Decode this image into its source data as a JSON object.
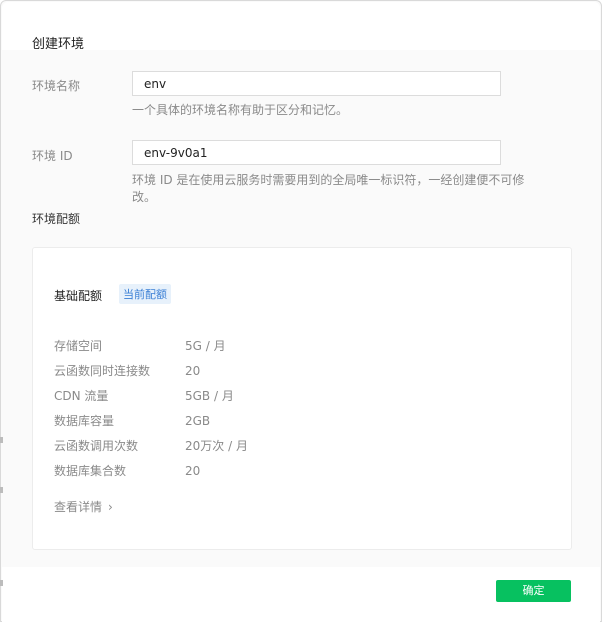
{
  "dialog": {
    "title": "创建环境",
    "confirm_label": "确定"
  },
  "form": {
    "env_name": {
      "label": "环境名称",
      "value": "env",
      "hint": "一个具体的环境名称有助于区分和记忆。"
    },
    "env_id": {
      "label": "环境 ID",
      "value": "env-9v0a1",
      "hint": "环境 ID 是在使用云服务时需要用到的全局唯一标识符，一经创建便不可修改。"
    }
  },
  "quota": {
    "section_title": "环境配额",
    "plan_name": "基础配额",
    "plan_badge": "当前配额",
    "rows": [
      {
        "key": "存储空间",
        "value": "5G / 月"
      },
      {
        "key": "云函数同时连接数",
        "value": "20"
      },
      {
        "key": "CDN 流量",
        "value": "5GB / 月"
      },
      {
        "key": "数据库容量",
        "value": "2GB"
      },
      {
        "key": "云函数调用次数",
        "value": "20万次 / 月"
      },
      {
        "key": "数据库集合数",
        "value": "20"
      }
    ],
    "details_link": "查看详情",
    "details_chevron": "›"
  },
  "colors": {
    "accent": "#07c160",
    "badge_bg": "#e7f1fb",
    "badge_text": "#3a7fd5"
  }
}
